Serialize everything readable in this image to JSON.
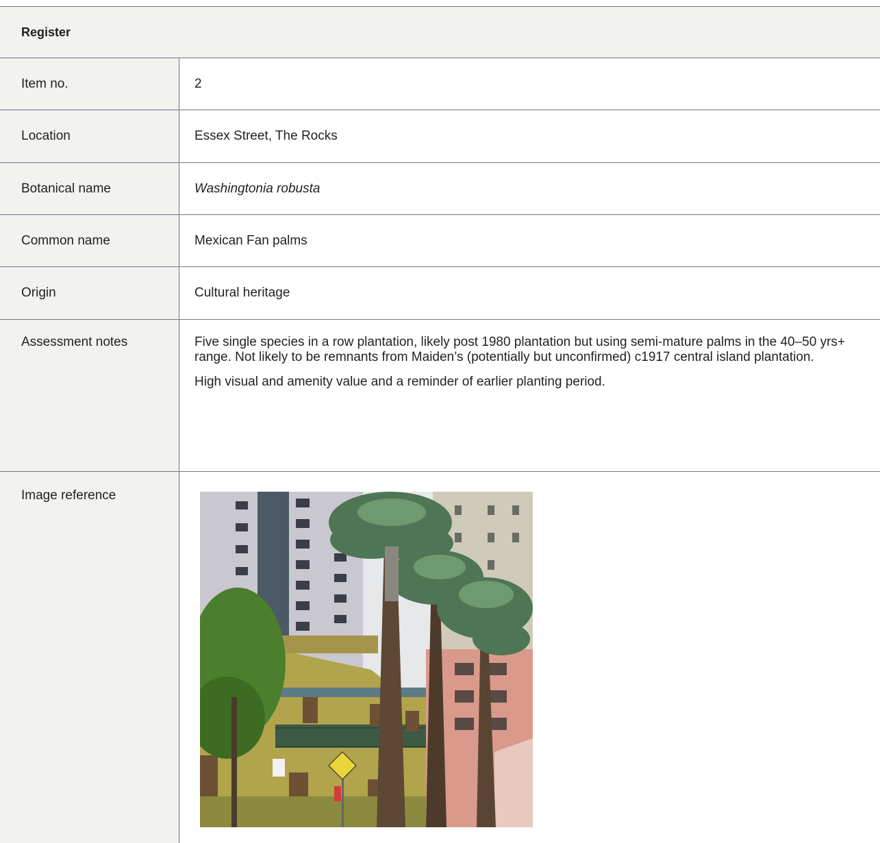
{
  "header": {
    "title": "Register"
  },
  "rows": [
    {
      "label": "Item no.",
      "value": "2"
    },
    {
      "label": "Location",
      "value": "Essex Street, The Rocks"
    },
    {
      "label": "Botanical name",
      "value": "Washingtonia robusta"
    },
    {
      "label": "Common name",
      "value": "Mexican Fan palms"
    },
    {
      "label": "Origin",
      "value": "Cultural heritage"
    }
  ],
  "notes": {
    "label": "Assessment notes",
    "paragraphs": [
      "Five single species in a row plantation, likely post 1980 plantation but using semi-mature palms in the 40–50 yrs+ range. Not likely to be remnants from Maiden’s (potentially but unconfirmed) c1917 central island plantation.",
      "High visual and amenity value and a reminder of earlier planting period."
    ]
  },
  "image_ref": {
    "label": "Image reference"
  }
}
